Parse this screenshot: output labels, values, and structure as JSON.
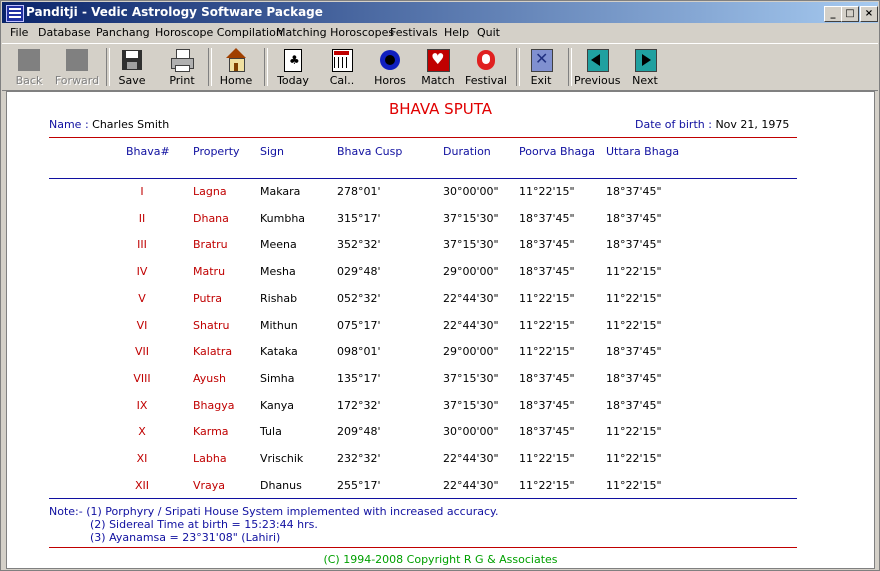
{
  "window": {
    "title": "Panditji - Vedic Astrology Software Package"
  },
  "menu": [
    "File",
    "Database",
    "Panchang",
    "Horoscope Compilation",
    "Matching Horoscopes",
    "Festivals",
    "Help",
    "Quit"
  ],
  "toolbar": {
    "back": "Back",
    "forward": "Forward",
    "save": "Save",
    "print": "Print",
    "home": "Home",
    "today": "Today",
    "cal": "Cal..",
    "horos": "Horos",
    "match": "Match",
    "festival": "Festival",
    "exit": "Exit",
    "previous": "Previous",
    "next": "Next"
  },
  "report": {
    "title": "BHAVA SPUTA",
    "name_label": "Name",
    "name_value": "Charles Smith",
    "dob_label": "Date of birth",
    "dob_value": "Nov 21, 1975",
    "headers": [
      "Bhava#",
      "Property",
      "Sign",
      "Bhava Cusp",
      "Duration",
      "Poorva Bhaga",
      "Uttara Bhaga"
    ],
    "rows": [
      [
        "I",
        "Lagna",
        "Makara",
        "278°01'",
        "30°00'00\"",
        "11°22'15\"",
        "18°37'45\""
      ],
      [
        "II",
        "Dhana",
        "Kumbha",
        "315°17'",
        "37°15'30\"",
        "18°37'45\"",
        "18°37'45\""
      ],
      [
        "III",
        "Bratru",
        "Meena",
        "352°32'",
        "37°15'30\"",
        "18°37'45\"",
        "18°37'45\""
      ],
      [
        "IV",
        "Matru",
        "Mesha",
        "029°48'",
        "29°00'00\"",
        "18°37'45\"",
        "11°22'15\""
      ],
      [
        "V",
        "Putra",
        "Rishab",
        "052°32'",
        "22°44'30\"",
        "11°22'15\"",
        "11°22'15\""
      ],
      [
        "VI",
        "Shatru",
        "Mithun",
        "075°17'",
        "22°44'30\"",
        "11°22'15\"",
        "11°22'15\""
      ],
      [
        "VII",
        "Kalatra",
        "Kataka",
        "098°01'",
        "29°00'00\"",
        "11°22'15\"",
        "18°37'45\""
      ],
      [
        "VIII",
        "Ayush",
        "Simha",
        "135°17'",
        "37°15'30\"",
        "18°37'45\"",
        "18°37'45\""
      ],
      [
        "IX",
        "Bhagya",
        "Kanya",
        "172°32'",
        "37°15'30\"",
        "18°37'45\"",
        "18°37'45\""
      ],
      [
        "X",
        "Karma",
        "Tula",
        "209°48'",
        "30°00'00\"",
        "18°37'45\"",
        "11°22'15\""
      ],
      [
        "XI",
        "Labha",
        "Vrischik",
        "232°32'",
        "22°44'30\"",
        "11°22'15\"",
        "11°22'15\""
      ],
      [
        "XII",
        "Vraya",
        "Dhanus",
        "255°17'",
        "22°44'30\"",
        "11°22'15\"",
        "11°22'15\""
      ]
    ],
    "notes": [
      "Note:- (1)   Porphyry / Sripati House System implemented with increased accuracy.",
      "(2)   Sidereal Time at birth = 15:23:44 hrs.",
      "(3)  Ayanamsa = 23°31'08\" (Lahiri)"
    ],
    "copyright": "(C) 1994-2008 Copyright R G & Associates"
  }
}
